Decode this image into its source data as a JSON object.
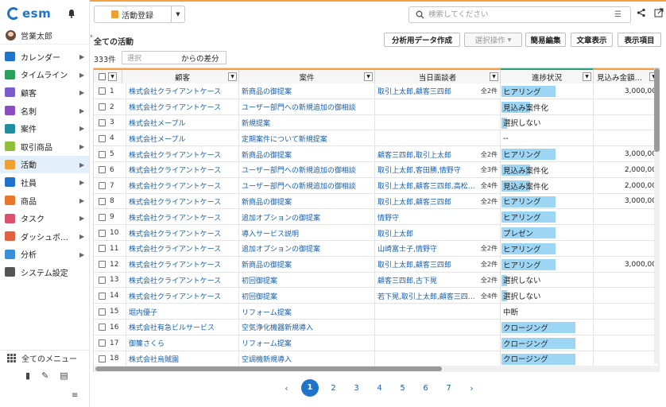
{
  "app": {
    "logo": "esm"
  },
  "user": {
    "name": "営業太郎"
  },
  "sidebar": {
    "items": [
      {
        "label": "カレンダー",
        "icon": "calendar-icon",
        "color": "#1f73c9",
        "chevron": true
      },
      {
        "label": "タイムライン",
        "icon": "timeline-icon",
        "color": "#2aa05a",
        "chevron": true
      },
      {
        "label": "顧客",
        "icon": "customer-icon",
        "color": "#7b5cc9",
        "chevron": true
      },
      {
        "label": "名刺",
        "icon": "business-card-icon",
        "color": "#8a4fbf",
        "chevron": true
      },
      {
        "label": "案件",
        "icon": "deal-icon",
        "color": "#1f8f9f",
        "chevron": true
      },
      {
        "label": "取引商品",
        "icon": "product-deal-icon",
        "color": "#8fbf3a",
        "chevron": true
      },
      {
        "label": "活動",
        "icon": "activity-icon",
        "color": "#f0a030",
        "chevron": true,
        "active": true
      },
      {
        "label": "社員",
        "icon": "employee-icon",
        "color": "#1f73c9",
        "chevron": true
      },
      {
        "label": "商品",
        "icon": "item-icon",
        "color": "#e8762b",
        "chevron": true
      },
      {
        "label": "タスク",
        "icon": "task-icon",
        "color": "#d9536f",
        "chevron": true
      },
      {
        "label": "ダッシュボ…",
        "icon": "dashboard-icon",
        "color": "#e06040",
        "chevron": true
      },
      {
        "label": "分析",
        "icon": "analysis-icon",
        "color": "#3a8fd9",
        "chevron": true
      },
      {
        "label": "システム設定",
        "icon": "gear-icon",
        "color": "#555555",
        "chevron": false
      }
    ],
    "all_menu": "全てのメニュー"
  },
  "topbar": {
    "new_activity": "活動登録",
    "search_placeholder": "検索してください"
  },
  "toolbar": {
    "title": "全ての活動",
    "analysis_data": "分析用データ作成",
    "select_ops": "選択操作",
    "simple_edit": "簡易編集",
    "text_display": "文章表示",
    "display_items": "表示項目",
    "count": "333件",
    "select_placeholder": "選択",
    "diff_label": "からの差分"
  },
  "table": {
    "headers": {
      "customer": "顧客",
      "deal": "案件",
      "interviewee": "当日面談者",
      "status": "進捗状況",
      "amount": "見込み金額…"
    },
    "rows": [
      {
        "no": "1",
        "customer": "株式会社クライアントケース",
        "deal": "新商品の御提案",
        "person": "取引上太郎,顧客三四郎",
        "count": "全2件",
        "status": "ヒアリング",
        "level": 0.6,
        "amount": "3,000,00"
      },
      {
        "no": "2",
        "customer": "株式会社クライアントケース",
        "deal": "ユーザー部門への新規追加の御相談",
        "person": "",
        "count": "",
        "status": "見込み案件化",
        "level": 0.32,
        "amount": ""
      },
      {
        "no": "3",
        "customer": "株式会社メープル",
        "deal": "新規提案",
        "person": "",
        "count": "",
        "status": "選択しない",
        "level": 0.06,
        "amount": ""
      },
      {
        "no": "4",
        "customer": "株式会社メープル",
        "deal": "定期案件について新規提案",
        "person": "",
        "count": "",
        "status": "--",
        "level": 0,
        "amount": ""
      },
      {
        "no": "5",
        "customer": "株式会社クライアントケース",
        "deal": "新商品の御提案",
        "person": "顧客三四郎,取引上太郎",
        "count": "全2件",
        "status": "ヒアリング",
        "level": 0.6,
        "amount": "3,000,00"
      },
      {
        "no": "6",
        "customer": "株式会社クライアントケース",
        "deal": "ユーザー部門への新規追加の御相談",
        "person": "取引上太郎,客田勝,情野守",
        "count": "全3件",
        "status": "見込み案件化",
        "level": 0.32,
        "amount": "2,000,00"
      },
      {
        "no": "7",
        "customer": "株式会社クライアントケース",
        "deal": "ユーザー部門への新規追加の御相談",
        "person": "取引上太郎,顧客三四郎,高松…",
        "count": "全4件",
        "status": "見込み案件化",
        "level": 0.32,
        "amount": "2,000,00"
      },
      {
        "no": "8",
        "customer": "株式会社クライアントケース",
        "deal": "新商品の御提案",
        "person": "取引上太郎,顧客三四郎",
        "count": "全2件",
        "status": "ヒアリング",
        "level": 0.6,
        "amount": "3,000,00"
      },
      {
        "no": "9",
        "customer": "株式会社クライアントケース",
        "deal": "追加オプションの御提案",
        "person": "情野守",
        "count": "",
        "status": "ヒアリング",
        "level": 0.6,
        "amount": ""
      },
      {
        "no": "10",
        "customer": "株式会社クライアントケース",
        "deal": "導入サービス説明",
        "person": "取引上太郎",
        "count": "",
        "status": "プレゼン",
        "level": 0.6,
        "amount": ""
      },
      {
        "no": "11",
        "customer": "株式会社クライアントケース",
        "deal": "追加オプションの御提案",
        "person": "山崎富士子,情野守",
        "count": "全2件",
        "status": "ヒアリング",
        "level": 0.6,
        "amount": ""
      },
      {
        "no": "12",
        "customer": "株式会社クライアントケース",
        "deal": "新商品の御提案",
        "person": "取引上太郎,顧客三四郎",
        "count": "全2件",
        "status": "ヒアリング",
        "level": 0.6,
        "amount": "3,000,00"
      },
      {
        "no": "13",
        "customer": "株式会社クライアントケース",
        "deal": "初回御提案",
        "person": "顧客三四郎,古下晃",
        "count": "全2件",
        "status": "選択しない",
        "level": 0.06,
        "amount": ""
      },
      {
        "no": "14",
        "customer": "株式会社クライアントケース",
        "deal": "初回御提案",
        "person": "若下晃,取引上太郎,顧客三四…",
        "count": "全4件",
        "status": "選択しない",
        "level": 0.06,
        "amount": ""
      },
      {
        "no": "15",
        "customer": "堀内優子",
        "deal": "リフォーム提案",
        "person": "",
        "count": "",
        "status": "中断",
        "level": 0,
        "amount": ""
      },
      {
        "no": "16",
        "customer": "株式会社有急ビルサービス",
        "deal": "空気浄化機器新規導入",
        "person": "",
        "count": "",
        "status": "クロージング",
        "level": 0.82,
        "amount": ""
      },
      {
        "no": "17",
        "customer": "御簾さくら",
        "deal": "リフォーム提案",
        "person": "",
        "count": "",
        "status": "クロージング",
        "level": 0.82,
        "amount": ""
      },
      {
        "no": "18",
        "customer": "株式会社烏賊園",
        "deal": "空調機新規導入",
        "person": "",
        "count": "",
        "status": "クロージング",
        "level": 0.82,
        "amount": ""
      }
    ]
  },
  "pagination": {
    "pages": [
      "1",
      "2",
      "3",
      "4",
      "5",
      "6",
      "7"
    ],
    "current": "1"
  }
}
